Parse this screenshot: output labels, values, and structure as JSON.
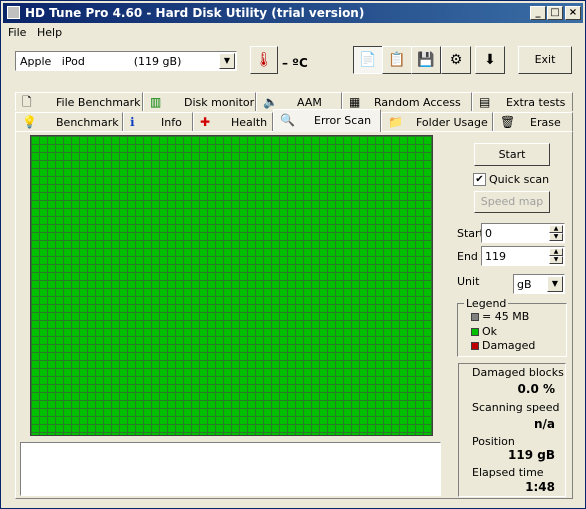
{
  "window": {
    "title": "HD Tune Pro 4.60 - Hard Disk Utility (trial version)",
    "min": "_",
    "max": "□",
    "close": "×"
  },
  "menu": {
    "file": "File",
    "help": "Help"
  },
  "toolbar": {
    "drive": "Apple   iPod              (119 gB)",
    "temperature": "– ºC",
    "exit": "Exit"
  },
  "tabs_top": [
    {
      "label": "File Benchmark",
      "icon": "file-benchmark-icon"
    },
    {
      "label": "Disk monitor",
      "icon": "disk-monitor-icon"
    },
    {
      "label": "AAM",
      "icon": "speaker-icon"
    },
    {
      "label": "Random Access",
      "icon": "random-access-icon"
    },
    {
      "label": "Extra tests",
      "icon": "extra-tests-icon"
    }
  ],
  "tabs_bottom": [
    {
      "label": "Benchmark",
      "icon": "lightbulb-icon"
    },
    {
      "label": "Info",
      "icon": "info-icon"
    },
    {
      "label": "Health",
      "icon": "health-cross-icon"
    },
    {
      "label": "Error Scan",
      "icon": "magnifier-icon"
    },
    {
      "label": "Folder Usage",
      "icon": "folder-icon"
    },
    {
      "label": "Erase",
      "icon": "trash-icon"
    }
  ],
  "scan": {
    "start": "Start",
    "quick_scan": "Quick scan",
    "quick_scan_checked": true,
    "speed_map": "Speed map",
    "start_label": "Start",
    "start_value": "0",
    "end_label": "End",
    "end_value": "119",
    "unit_label": "Unit",
    "unit_value": "gB"
  },
  "legend": {
    "title": "Legend",
    "block": "= 45 MB",
    "ok": "Ok",
    "damaged": "Damaged",
    "colors": {
      "block": "#808080",
      "ok": "#00c000",
      "damaged": "#c00000"
    }
  },
  "stats": {
    "damaged_label": "Damaged blocks",
    "damaged_value": "0.0 %",
    "speed_label": "Scanning speed",
    "speed_value": "n/a",
    "position_label": "Position",
    "position_value": "119 gB",
    "elapsed_label": "Elapsed time",
    "elapsed_value": "1:48"
  }
}
